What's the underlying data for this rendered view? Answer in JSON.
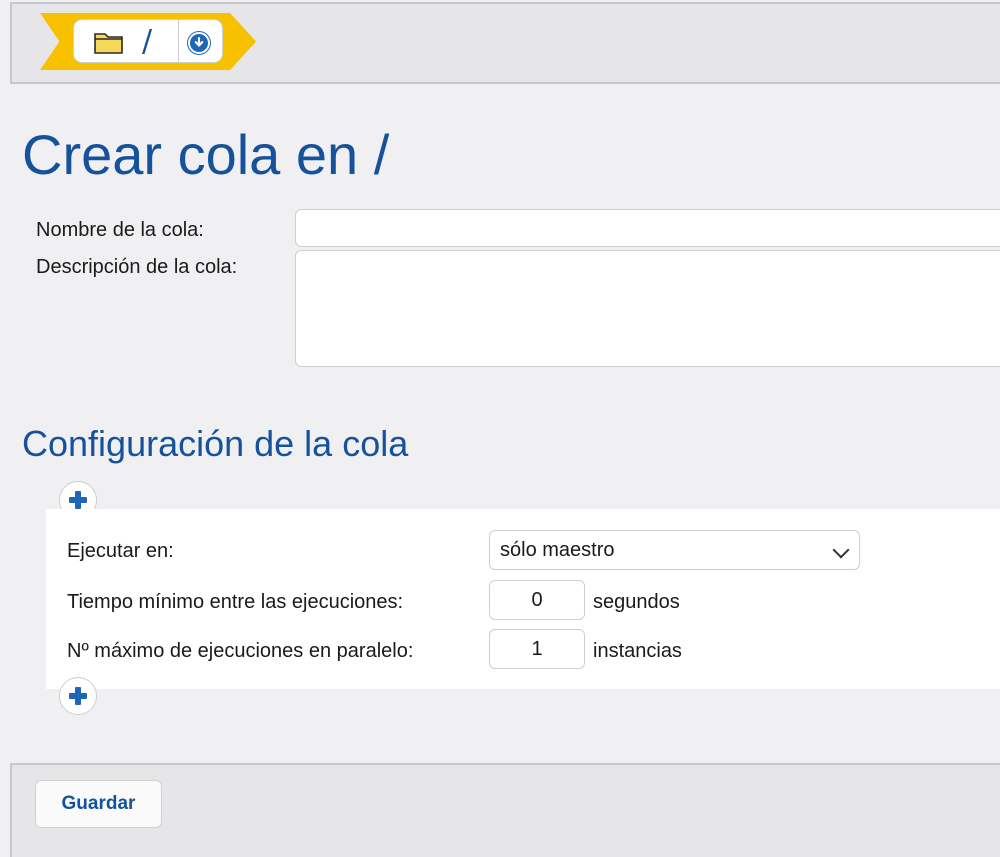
{
  "breadcrumb": {
    "separator": "/",
    "folder_icon": "folder-icon",
    "dropdown_icon": "chevron-down-circle-icon"
  },
  "page_title": "Crear cola en /",
  "form": {
    "name_label": "Nombre de la cola:",
    "name_value": "",
    "description_label": "Descripción de la cola:",
    "description_value": ""
  },
  "config": {
    "section_title": "Configuración de la cola",
    "run_on_label": "Ejecutar en:",
    "run_on_value": "sólo maestro",
    "min_time_label": "Tiempo mínimo entre las ejecuciones:",
    "min_time_value": "0",
    "min_time_unit": "segundos",
    "max_parallel_label": "Nº máximo de ejecuciones en paralelo:",
    "max_parallel_value": "1",
    "max_parallel_unit": "instancias"
  },
  "footer": {
    "save_label": "Guardar"
  },
  "colors": {
    "accent": "#15529b",
    "breadcrumb_arrow": "#f8c100",
    "icon_blue": "#1f66b8"
  }
}
